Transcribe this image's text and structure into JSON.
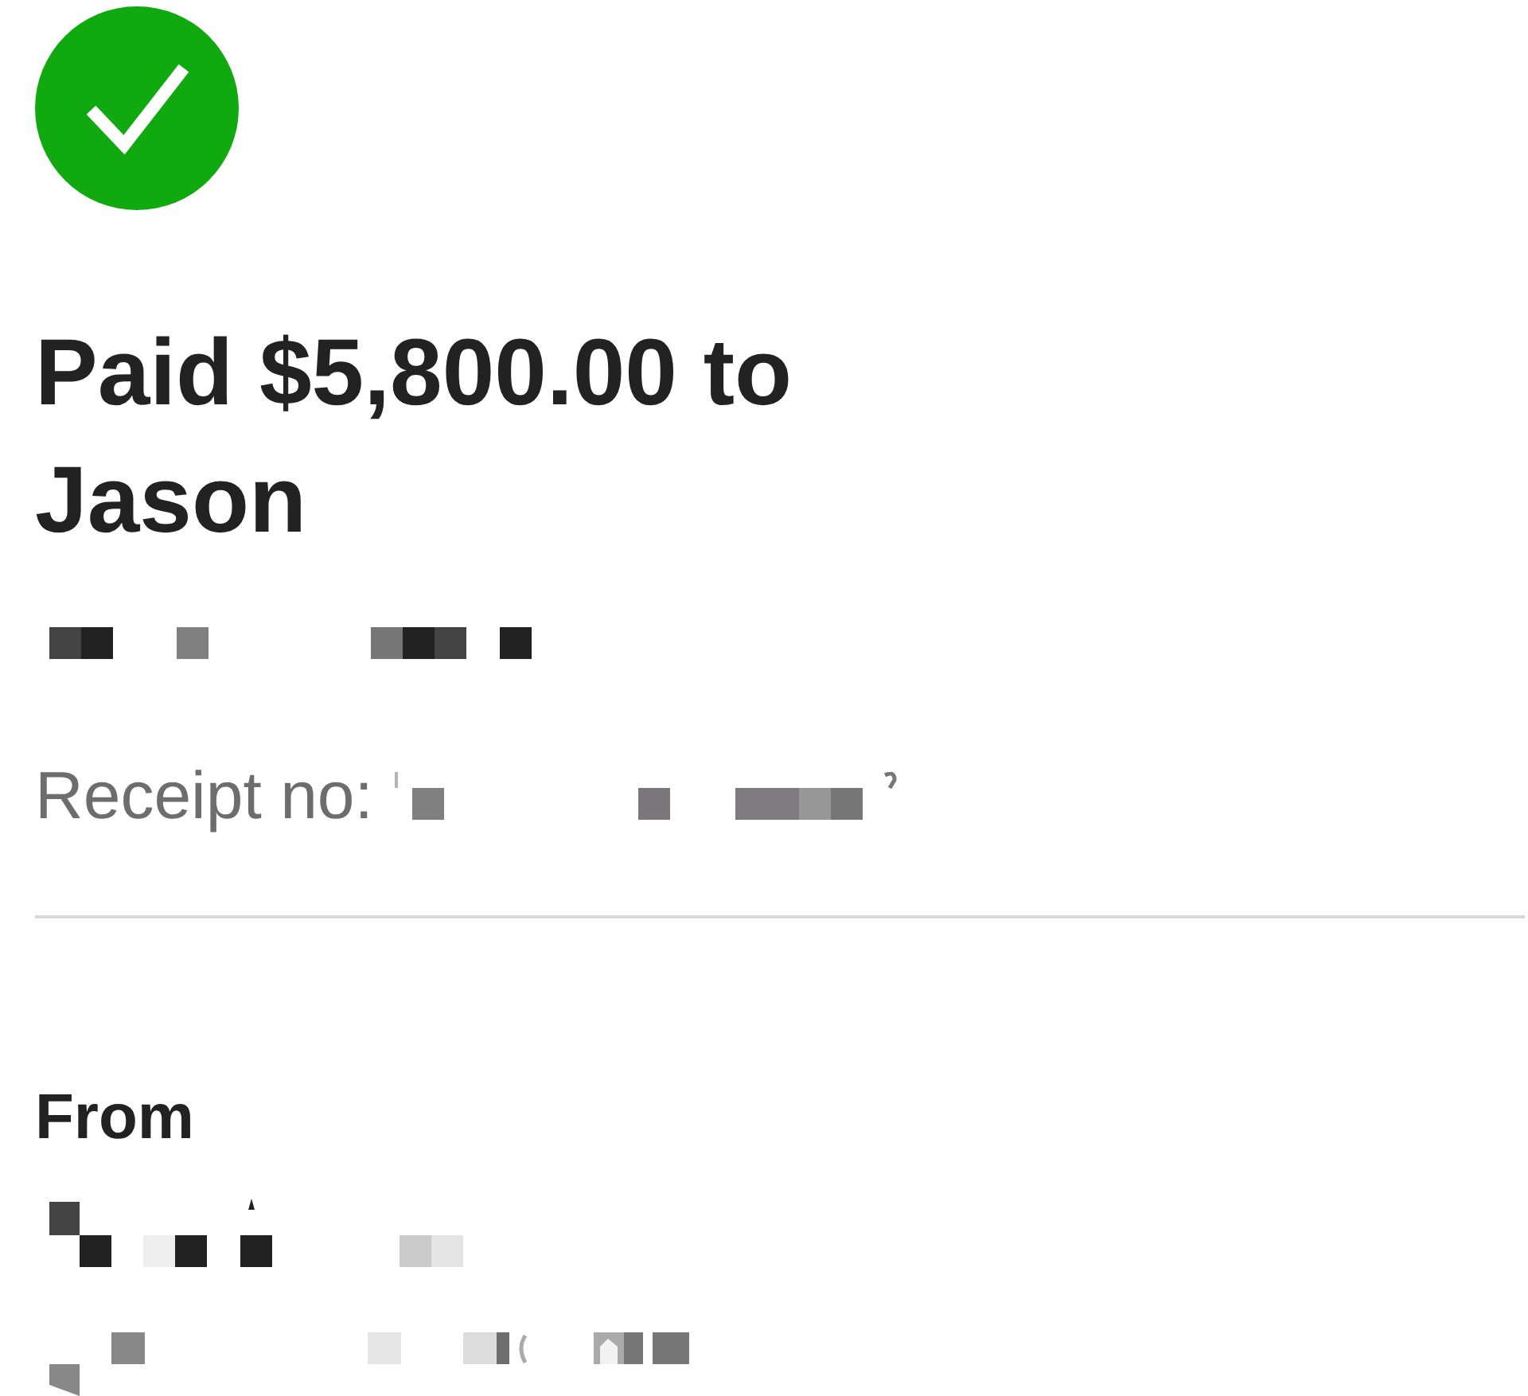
{
  "heading": "Paid $5,800.00 to Jason",
  "detail_lines": [
    {
      "redacted": true
    }
  ],
  "receipt": {
    "label": "Receipt no:",
    "value_redacted": true
  },
  "from": {
    "title": "From",
    "lines": [
      {
        "redacted": true
      },
      {
        "redacted": true
      }
    ]
  }
}
